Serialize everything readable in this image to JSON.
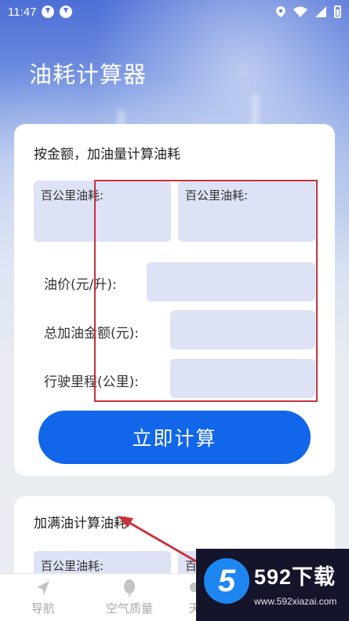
{
  "status_bar": {
    "time": "11:47"
  },
  "app": {
    "title": "油耗计算器"
  },
  "card1": {
    "title": "按金额，加油量计算油耗",
    "result_left_label": "百公里油耗:",
    "result_right_label": "百公里油耗:",
    "fields": {
      "price_label": "油价(元/升):",
      "price_value": "",
      "amount_label": "总加油金额(元):",
      "amount_value": "",
      "distance_label": "行驶里程(公里):",
      "distance_value": ""
    },
    "calc_button_label": "立即计算"
  },
  "card2": {
    "title": "加满油计算油耗",
    "result_left_label": "百公里油耗:",
    "result_right_label": "百"
  },
  "bottom_nav": {
    "items": [
      {
        "label": "导航",
        "icon": "navigation-icon"
      },
      {
        "label": "空气质量",
        "icon": "balloon-icon"
      },
      {
        "label": "天",
        "icon": "weather-icon"
      }
    ]
  },
  "watermark": {
    "logo_char": "5",
    "brand": "592下载",
    "url": "www.592xiazai.com"
  },
  "colors": {
    "accent": "#1166ea",
    "input_bg": "#dde2f5",
    "annotation_red": "#c8323c"
  }
}
